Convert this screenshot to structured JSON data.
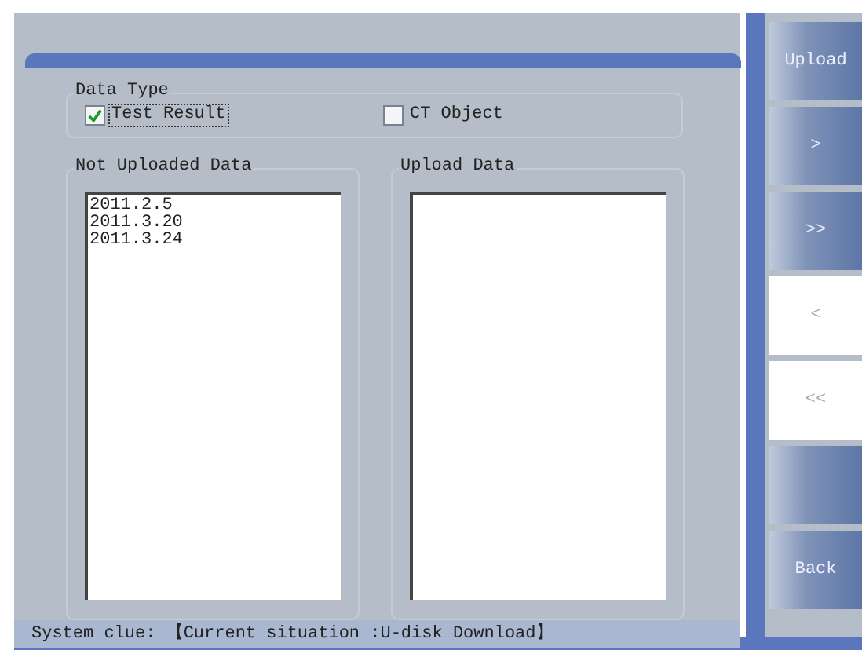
{
  "data_type": {
    "legend": "Data Type",
    "options": [
      {
        "label": "Test Result",
        "checked": true,
        "focused": true
      },
      {
        "label": "CT Object",
        "checked": false,
        "focused": false
      }
    ]
  },
  "lists": [
    {
      "legend": "Not Uploaded Data",
      "items": [
        "2011.2.5",
        "2011.3.20",
        "2011.3.24"
      ]
    },
    {
      "legend": "Upload Data"
    }
  ],
  "buttons": [
    {
      "label": "Upload",
      "disabled": false
    },
    {
      "label": ">",
      "disabled": false
    },
    {
      "label": ">>",
      "disabled": false
    },
    {
      "label": "<",
      "disabled": true
    },
    {
      "label": "<<",
      "disabled": true
    },
    {
      "disabled": false
    },
    {
      "label": "Back",
      "disabled": false
    }
  ],
  "status_bar": {
    "text": "System clue: 【Current situation :U-disk Download】"
  }
}
